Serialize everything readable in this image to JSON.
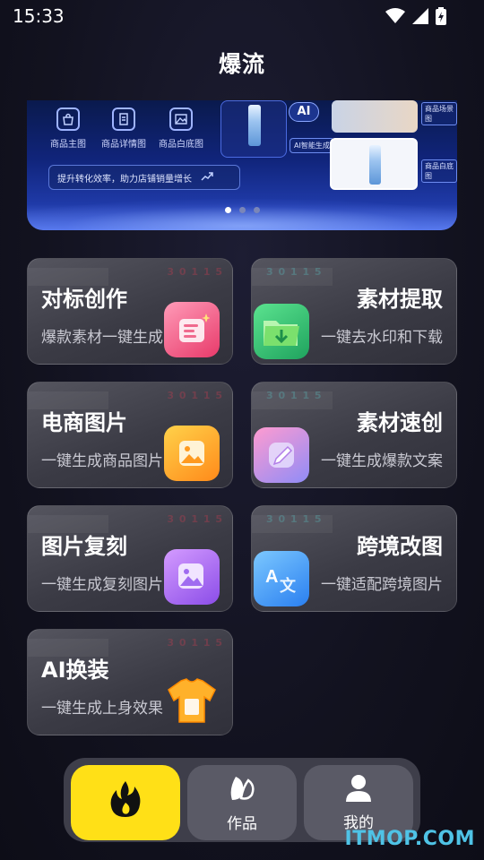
{
  "status_bar": {
    "time": "15:33",
    "icons": [
      "wifi-icon",
      "signal-icon",
      "battery-charging-icon"
    ]
  },
  "page": {
    "title": "爆流"
  },
  "banner": {
    "features": [
      {
        "icon": "bag-icon",
        "label": "商品主图"
      },
      {
        "icon": "document-icon",
        "label": "商品详情图"
      },
      {
        "icon": "image-icon",
        "label": "商品白底图"
      }
    ],
    "slogan": "提升转化效率，助力店铺销量增长",
    "ai_badge": "AI",
    "ai_tag": "AI智能生成",
    "thumb_tag_top": "商品场景图",
    "thumb_tag_bottom": "商品白底图",
    "carousel": {
      "count": 3,
      "active": 0
    }
  },
  "cards": [
    {
      "id": "benchmark",
      "title": "对标创作",
      "subtitle": "爆款素材一键生成",
      "icon": "document-stack-icon",
      "icon_color": "#f0567a",
      "side": "left",
      "watermark": "3 0 1 1 5"
    },
    {
      "id": "extract",
      "title": "素材提取",
      "subtitle": "一键去水印和下载",
      "icon": "folder-download-icon",
      "icon_color": "#2fcf7a",
      "side": "right",
      "watermark": "3 0 1 1 5"
    },
    {
      "id": "ecommerce",
      "title": "电商图片",
      "subtitle": "一键生成商品图片",
      "icon": "picture-icon",
      "icon_color": "#ff9a1f",
      "side": "left",
      "watermark": "3 0 1 1 5"
    },
    {
      "id": "quick",
      "title": "素材速创",
      "subtitle": "一键生成爆款文案",
      "icon": "pen-icon",
      "icon_color": "#b68cf5",
      "side": "right",
      "watermark": "3 0 1 1 5"
    },
    {
      "id": "copy",
      "title": "图片复刻",
      "subtitle": "一键生成复刻图片",
      "icon": "mountain-image-icon",
      "icon_color": "#a06cf0",
      "side": "left",
      "watermark": "3 0 1 1 5"
    },
    {
      "id": "cross",
      "title": "跨境改图",
      "subtitle": "一键适配跨境图片",
      "icon": "translate-icon",
      "icon_color": "#3aa0f5",
      "side": "right",
      "watermark": "3 0 1 1 5"
    },
    {
      "id": "outfit",
      "title": "AI换装",
      "subtitle": "一键生成上身效果",
      "icon": "tshirt-icon",
      "icon_color": "#ffb12a",
      "side": "left",
      "watermark": "3 0 1 1 5"
    }
  ],
  "nav": {
    "items": [
      {
        "id": "home",
        "icon": "flame-icon",
        "label": "",
        "active": true
      },
      {
        "id": "works",
        "icon": "works-icon",
        "label": "作品",
        "active": false
      },
      {
        "id": "mine",
        "icon": "user-icon",
        "label": "我的",
        "active": false
      }
    ]
  },
  "watermark": "ITMOP.COM"
}
